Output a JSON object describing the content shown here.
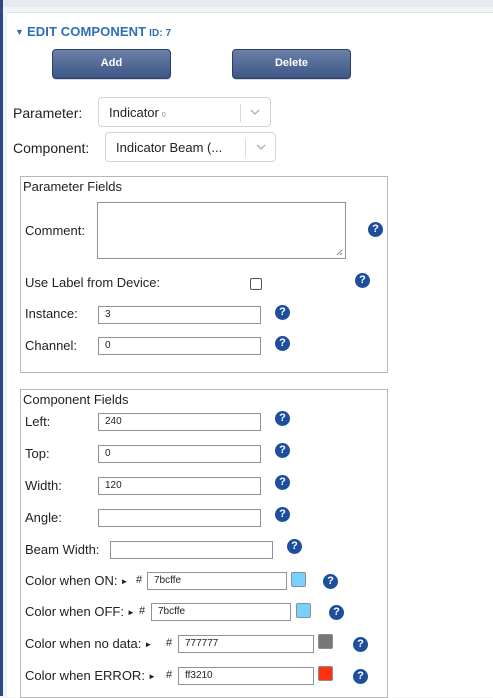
{
  "header": {
    "title": "EDIT COMPONENT",
    "id_label": "ID: 7"
  },
  "buttons": {
    "add": "Add",
    "delete": "Delete"
  },
  "parameter": {
    "label": "Parameter:",
    "value": "Indicator",
    "suffix": "0"
  },
  "component": {
    "label": "Component:",
    "value": "Indicator Beam (..."
  },
  "parameter_fields": {
    "title": "Parameter Fields",
    "comment_label": "Comment:",
    "use_label_label": "Use Label from Device:",
    "use_label_checked": false,
    "instance_label": "Instance:",
    "instance_value": "3",
    "channel_label": "Channel:",
    "channel_value": "0"
  },
  "component_fields": {
    "title": "Component Fields",
    "left_label": "Left:",
    "left_value": "240",
    "top_label": "Top:",
    "top_value": "0",
    "width_label": "Width:",
    "width_value": "120",
    "angle_label": "Angle:",
    "angle_value": "",
    "beam_width_label": "Beam Width:",
    "beam_width_value": "",
    "colors": [
      {
        "label": "Color when ON:",
        "hex": "7bcffe",
        "swatch": "#7bcffe"
      },
      {
        "label": "Color when OFF:",
        "hex": "7bcffe",
        "swatch": "#7bcffe"
      },
      {
        "label": "Color when no data:",
        "hex": "777777",
        "swatch": "#777777"
      },
      {
        "label": "Color when ERROR:",
        "hex": "ff3210",
        "swatch": "#ff3210"
      }
    ]
  },
  "help_glyph": "?",
  "hash_glyph": "#",
  "arrow_glyph": "►",
  "theme": {
    "accent": "#2e6fb8",
    "button": "#3d5686",
    "help": "#1d4f9b"
  }
}
